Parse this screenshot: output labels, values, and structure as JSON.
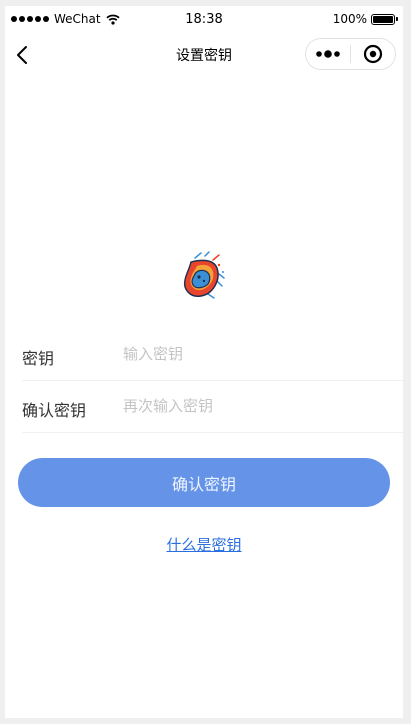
{
  "status_bar": {
    "carrier": "WeChat",
    "time": "18:38",
    "battery_text": "100%"
  },
  "nav": {
    "title": "设置密钥",
    "back_icon": "chevron-left-icon",
    "more_icon": "more-dots-icon",
    "close_icon": "target-circle-icon"
  },
  "logo": {
    "icon": "flaming-meteor-icon",
    "colors": {
      "flame": "#e8452c",
      "core": "#3a8fd6",
      "accent": "#f4a23a"
    }
  },
  "form": {
    "key_label": "密钥",
    "key_placeholder": "输入密钥",
    "key_value": "",
    "confirm_label": "确认密钥",
    "confirm_placeholder": "再次输入密钥",
    "confirm_value": ""
  },
  "actions": {
    "confirm_button": "确认密钥",
    "help_link": "什么是密钥"
  },
  "colors": {
    "primary_button": "#6493e8",
    "link": "#2a6fe0"
  }
}
